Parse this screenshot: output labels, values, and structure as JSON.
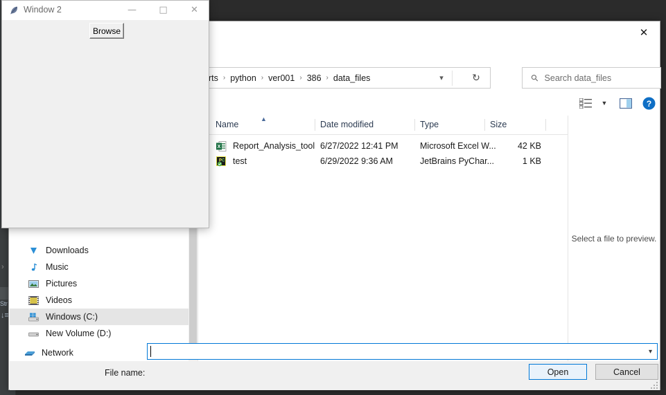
{
  "ide": {
    "rail_label": "Str",
    "chevron_icon": "chevron-right-icon",
    "sort_icon": "sort-icon"
  },
  "file_dialog": {
    "close_icon": "close-icon",
    "nav": {
      "back_icon": "back-arrow-icon",
      "forward_icon": "forward-arrow-icon",
      "up_icon": "up-arrow-icon",
      "dropdown_icon": "chevron-down-icon",
      "refresh_icon": "refresh-icon"
    },
    "breadcrumb": {
      "separator": "›",
      "items": [
        {
          "label": "rts"
        },
        {
          "label": "python"
        },
        {
          "label": "ver001"
        },
        {
          "label": "386"
        },
        {
          "label": "data_files"
        }
      ]
    },
    "search": {
      "icon": "search-icon",
      "placeholder": "Search data_files",
      "value": ""
    },
    "toolbar": {
      "view_options_icon": "view-options-icon",
      "view_chevron_icon": "chevron-down-icon",
      "preview_pane_icon": "preview-pane-icon",
      "help_icon": "help-icon"
    },
    "sidebar": {
      "items": [
        {
          "label": "Downloads",
          "icon": "downloads-icon",
          "state": "partial"
        },
        {
          "label": "Music",
          "icon": "music-icon",
          "state": "normal"
        },
        {
          "label": "Pictures",
          "icon": "pictures-icon",
          "state": "normal"
        },
        {
          "label": "Videos",
          "icon": "videos-icon",
          "state": "normal"
        },
        {
          "label": "Windows (C:)",
          "icon": "drive-windows-icon",
          "state": "selected"
        },
        {
          "label": "New Volume (D:)",
          "icon": "drive-icon",
          "state": "normal"
        },
        {
          "label": "Network",
          "icon": "network-icon",
          "state": "normal"
        }
      ],
      "scroll_down_icon": "chevron-down-icon"
    },
    "filelist": {
      "columns": [
        {
          "label": "Name"
        },
        {
          "label": "Date modified"
        },
        {
          "label": "Type"
        },
        {
          "label": "Size"
        }
      ],
      "sort_arrow_icon": "sort-ascending-icon",
      "rows": [
        {
          "name": "Report_Analysis_tool",
          "date": "6/27/2022 12:41 PM",
          "type": "Microsoft Excel W...",
          "size": "42 KB",
          "icon": "excel-file-icon"
        },
        {
          "name": "test",
          "date": "6/29/2022 9:36 AM",
          "type": "JetBrains PyChar...",
          "size": "1 KB",
          "icon": "pycharm-file-icon"
        }
      ]
    },
    "preview": {
      "text": "Select a file to preview."
    },
    "bottom": {
      "filename_label": "File name:",
      "filename_value": "",
      "filename_chevron_icon": "chevron-down-icon",
      "open_label": "Open",
      "cancel_label": "Cancel",
      "resize_grip_icon": "resize-grip-icon"
    },
    "colors": {
      "accent": "#0078d7",
      "selection": "#cfe8ff",
      "help_blue": "#0f6fc5"
    }
  },
  "tk_window": {
    "title": "Window 2",
    "app_icon": "feather-icon",
    "minimize_icon": "minimize-icon",
    "maximize_icon": "maximize-icon",
    "close_icon": "close-icon",
    "browse_label": "Browse"
  }
}
